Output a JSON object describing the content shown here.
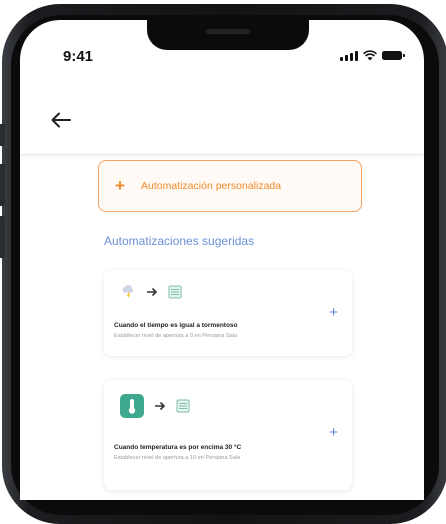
{
  "status_bar": {
    "time": "9:41"
  },
  "custom_automation": {
    "plus": "+",
    "label": "Automatización personalizada"
  },
  "suggested": {
    "title": "Automatizaciones sugeridas",
    "cards": [
      {
        "title": "Cuando el tiempo es igual a tormentoso",
        "description": "Establecer nivel de apertura a 0 en Persiana Sala",
        "add": "+",
        "trigger_icon": "storm-weather-icon",
        "action_icon": "blind-icon"
      },
      {
        "title": "Cuando temperatura es por encima 30 °C",
        "description": "Establecer nivel de apertura a 10 en Persiana Sala",
        "add": "+",
        "trigger_icon": "thermometer-icon",
        "action_icon": "blind-icon"
      }
    ]
  },
  "colors": {
    "accent": "#f08a2c",
    "link": "#5b86e0",
    "section": "#6b8fd9",
    "thermo_tile": "#3ea98e"
  }
}
